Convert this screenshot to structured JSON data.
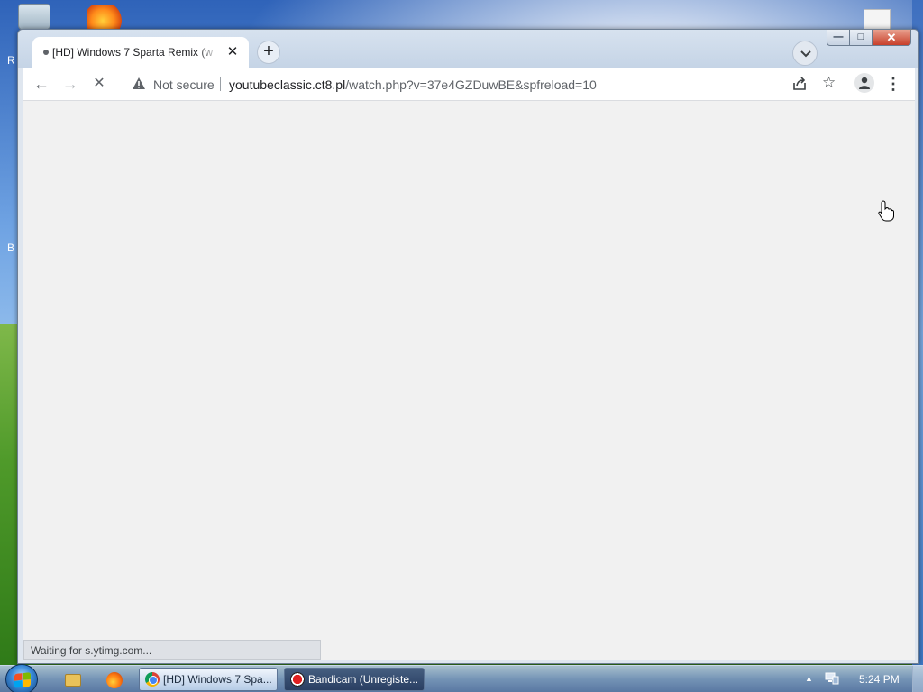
{
  "desktop": {
    "icons": [
      "recycle-bin-icon",
      "firefox-icon",
      "document-icon"
    ],
    "left_letters": [
      "R",
      "B"
    ]
  },
  "browser": {
    "tab": {
      "title": "[HD] Windows 7 Sparta Remix (w",
      "close": "✕"
    },
    "new_tab": "+",
    "window_controls": {
      "minimize": "—",
      "maximize": "□",
      "close": "✕"
    },
    "toolbar": {
      "back": "←",
      "forward": "→",
      "stop": "✕",
      "security_label": "Not secure",
      "url_domain": "youtubeclassic.ct8.pl",
      "url_path": "/watch.php?v=37e4GZDuwBE&spfreload=10",
      "bookmark": "☆",
      "menu": "⋮"
    },
    "status_text": "Waiting for s.ytimg.com...",
    "content_bg": "#f1f1f1"
  },
  "taskbar": {
    "tasks": [
      {
        "label": "[HD] Windows 7 Spa...",
        "icon": "chrome-icon"
      },
      {
        "label": "Bandicam (Unregiste...",
        "icon": "bandicam-icon"
      }
    ],
    "tray_arrow": "▲",
    "clock": "5:24 PM"
  }
}
